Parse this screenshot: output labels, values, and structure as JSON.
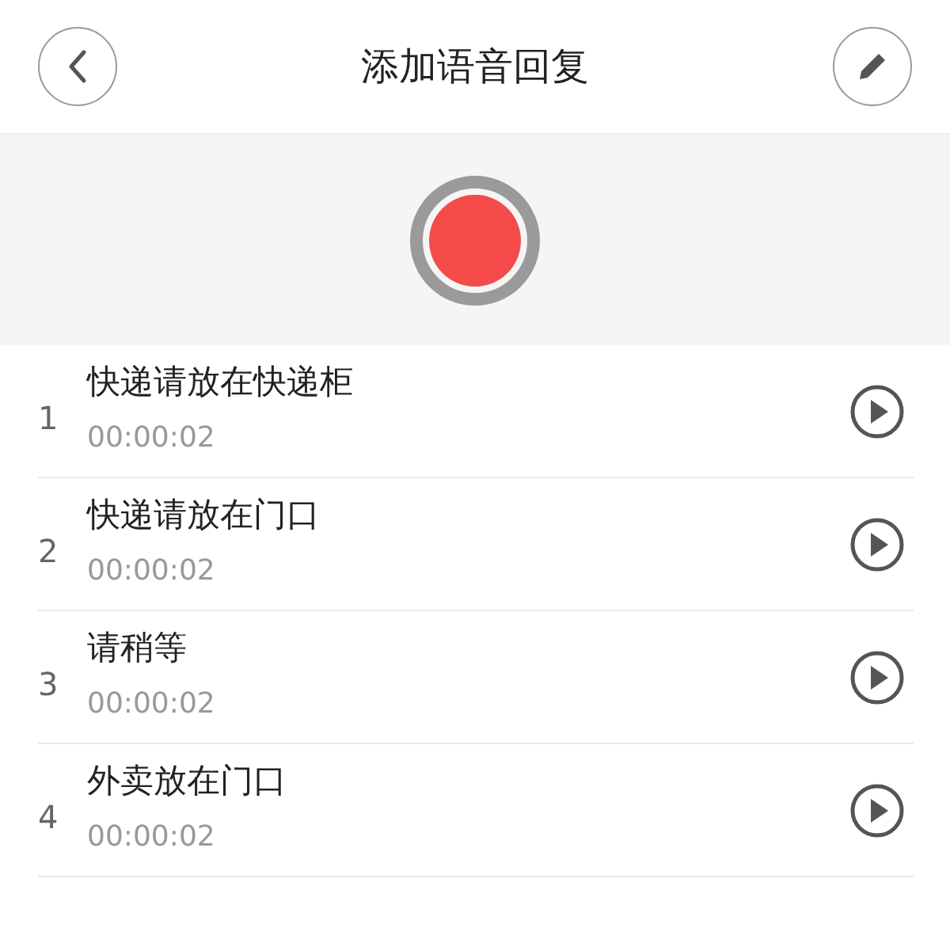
{
  "header": {
    "title": "添加语音回复"
  },
  "recordings": [
    {
      "index": "1",
      "title": "快递请放在快递柜",
      "duration": "00:00:02"
    },
    {
      "index": "2",
      "title": "快递请放在门口",
      "duration": "00:00:02"
    },
    {
      "index": "3",
      "title": "请稍等",
      "duration": "00:00:02"
    },
    {
      "index": "4",
      "title": "外卖放在门口",
      "duration": "00:00:02"
    }
  ]
}
